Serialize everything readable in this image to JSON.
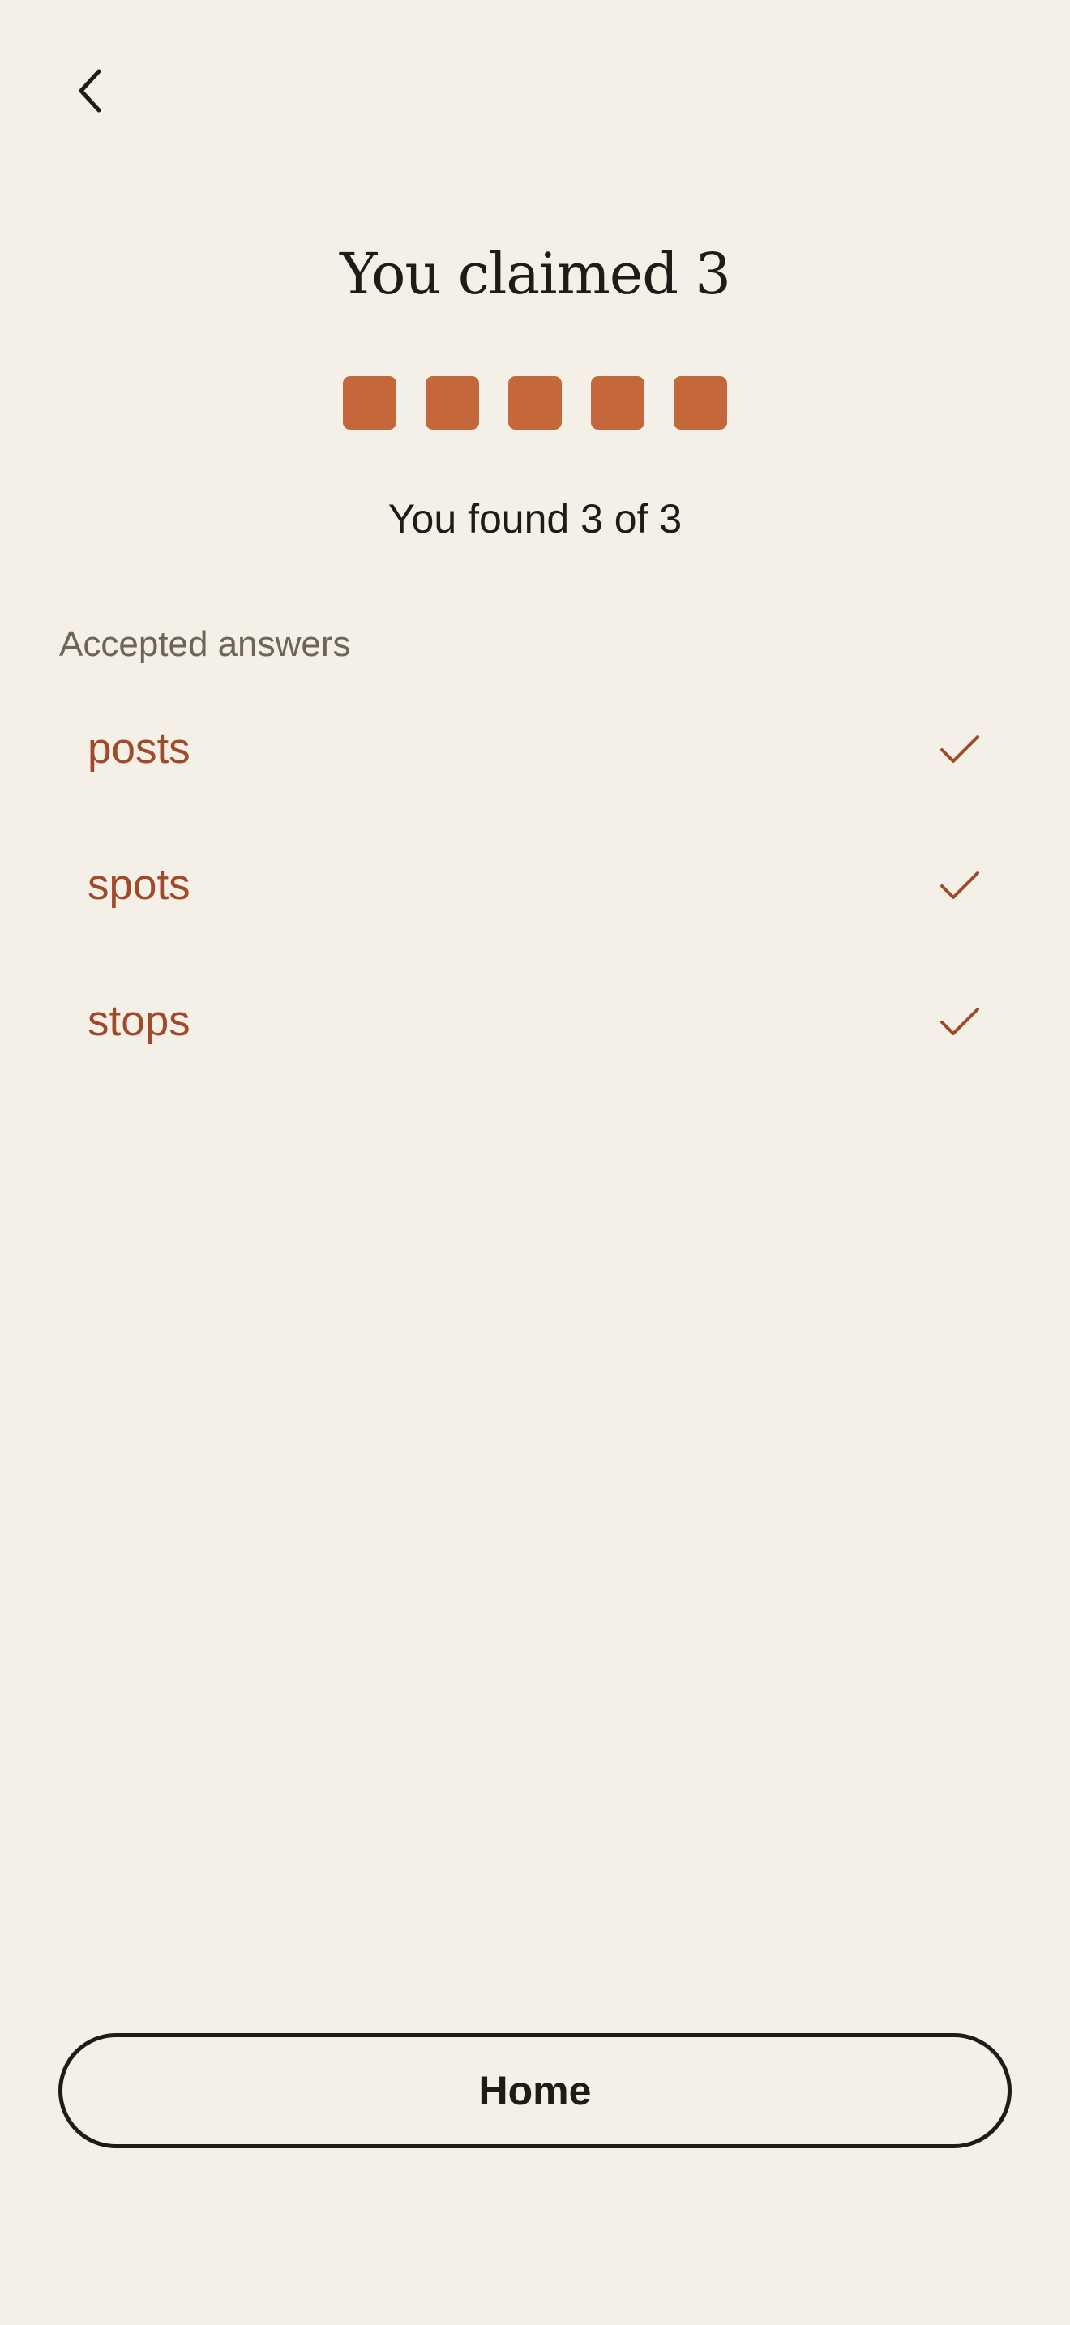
{
  "nav": {
    "back_icon": "chevron-left-icon"
  },
  "result": {
    "title": "You claimed 3",
    "tiles": 5,
    "summary": "You found 3 of 3"
  },
  "answers_section": {
    "label": "Accepted answers",
    "items": [
      {
        "label": "posts",
        "status_icon": "check-icon"
      },
      {
        "label": "spots",
        "status_icon": "check-icon"
      },
      {
        "label": "stops",
        "status_icon": "check-icon"
      }
    ]
  },
  "footer": {
    "home_label": "Home"
  },
  "colors": {
    "background": "#f5f0e7",
    "tile": "#c4673a",
    "answer_text": "#a04a2a",
    "muted_text": "#6b6659",
    "primary_text": "#1e1b18"
  }
}
